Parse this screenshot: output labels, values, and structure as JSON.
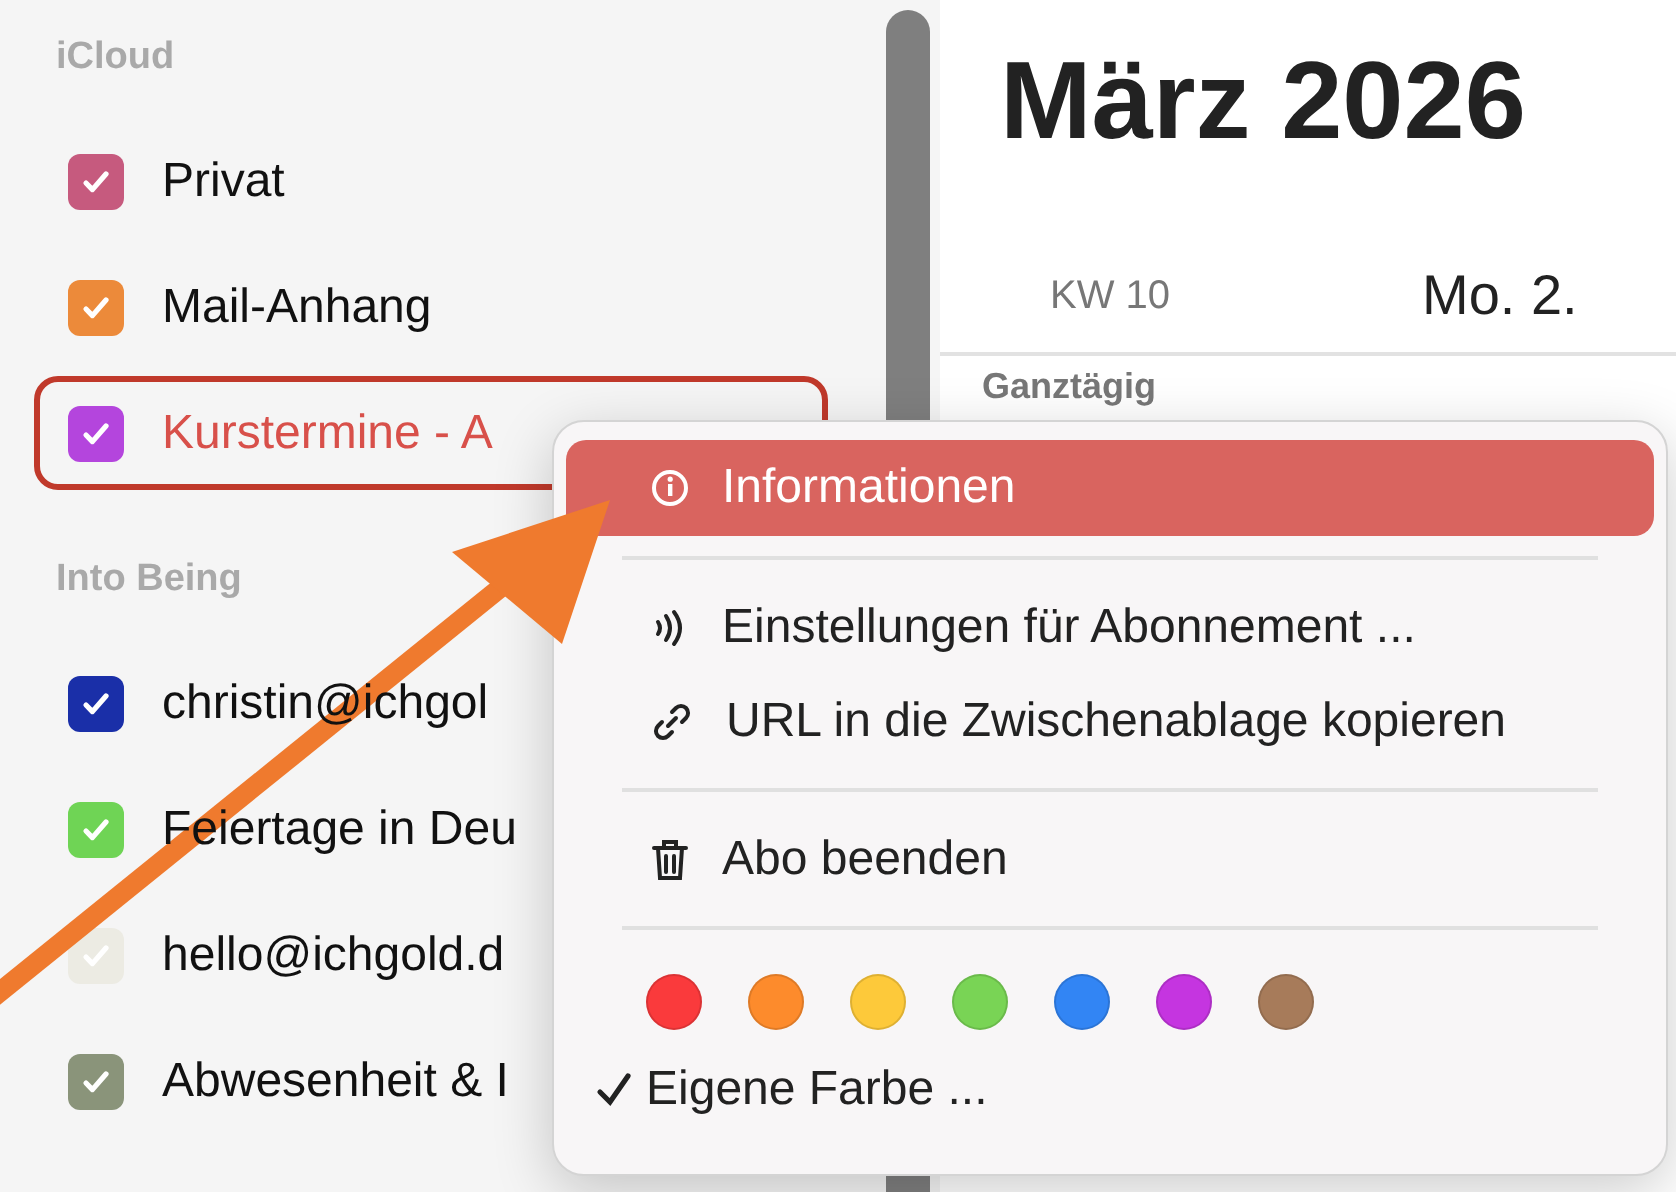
{
  "sidebar": {
    "sections": [
      {
        "title": "iCloud",
        "calendars": [
          {
            "name": "Privat",
            "color": "#c65a7e",
            "checked": true,
            "selected": false
          },
          {
            "name": "Mail-Anhang",
            "color": "#ec8a3a",
            "checked": true,
            "selected": false
          },
          {
            "name": "Kurstermine - A",
            "color": "#b445dd",
            "checked": true,
            "selected": true
          }
        ]
      },
      {
        "title": "Into Being",
        "calendars": [
          {
            "name": "christin@ichgol",
            "color": "#1a2fa8",
            "checked": true,
            "selected": false
          },
          {
            "name": "Feiertage in Deu",
            "color": "#6fd455",
            "checked": true,
            "selected": false
          },
          {
            "name": "hello@ichgold.d",
            "color": "#ecebe3",
            "checked": true,
            "selected": false
          },
          {
            "name": "Abwesenheit & I",
            "color": "#8a947a",
            "checked": true,
            "selected": false
          }
        ]
      }
    ]
  },
  "calendar": {
    "title": "März 2026",
    "week": "KW 10",
    "day": "Mo. 2.",
    "all_day": "Ganztägig"
  },
  "context_menu": {
    "groups": [
      [
        {
          "label": "Informationen",
          "selected": true
        }
      ],
      [
        {
          "label": "Einstellungen für Abonnement ...",
          "selected": false
        },
        {
          "label": "URL in die Zwischenablage kopieren",
          "selected": false
        }
      ],
      [
        {
          "label": "Abo beenden",
          "selected": false
        }
      ]
    ],
    "colors": [
      {
        "color": "#fa3a3c"
      },
      {
        "color": "#fd8b2c"
      },
      {
        "color": "#fdc93a"
      },
      {
        "color": "#79d455"
      },
      {
        "color": "#3285f4"
      },
      {
        "color": "#c535e0"
      },
      {
        "color": "#a77b5a"
      }
    ],
    "custom_color": {
      "label": "Eigene Farbe ...",
      "checked": true
    }
  }
}
